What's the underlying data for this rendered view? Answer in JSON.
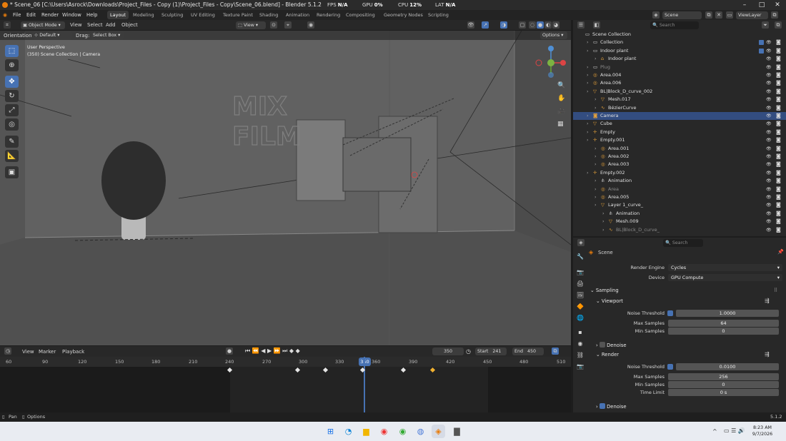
{
  "title_bar": {
    "title": "* Scene_06 [C:\\Users\\Asrock\\Downloads\\Project_Files - Copy (1)\\Project_Files - Copy\\Scene_06.blend] - Blender 5.1.2"
  },
  "stats": {
    "fps_label": "FPS",
    "fps_value": "N/A",
    "gpu_label": "GPU",
    "gpu_value": "0%",
    "cpu_label": "CPU",
    "cpu_value": "12%",
    "lat_label": "LAT",
    "lat_value": "N/A"
  },
  "menu": {
    "file": "File",
    "edit": "Edit",
    "render": "Render",
    "window": "Window",
    "help": "Help"
  },
  "workspaces": [
    "Layout",
    "Modeling",
    "Sculpting",
    "UV Editing",
    "Texture Paint",
    "Shading",
    "Animation",
    "Rendering",
    "Compositing",
    "Geometry Nodes",
    "Scripting"
  ],
  "scene_field": "Scene",
  "viewlayer_field": "ViewLayer",
  "viewport_header": {
    "mode": "Object Mode",
    "view": "View",
    "select": "Select",
    "add": "Add",
    "object": "Object",
    "view_dd": "View",
    "options": "Options"
  },
  "viewport_header2": {
    "orientation_label": "Orientation:",
    "orientation": "Default",
    "drag_label": "Drag:",
    "drag": "Select Box"
  },
  "viewport_overlay": {
    "line1": "User Perspective",
    "line2": "(350) Scene Collection | Camera"
  },
  "viewport_text": {
    "mix": "MIX",
    "film": "FILM"
  },
  "timeline": {
    "editor_menu": [
      "View",
      "Marker",
      "Playback"
    ],
    "current_frame": "350",
    "start_label": "Start",
    "start": "241",
    "end_label": "End",
    "end": "450",
    "ruler": [
      "60",
      "90",
      "120",
      "150",
      "180",
      "210",
      "240",
      "270",
      "300",
      "330",
      "360",
      "390",
      "420",
      "450",
      "480",
      "510"
    ],
    "playhead": "350"
  },
  "outliner": {
    "search_placeholder": "Search",
    "rows": [
      {
        "label": "Scene Collection",
        "indent": 0,
        "icon": "collection-icon"
      },
      {
        "label": "Collection",
        "indent": 1,
        "icon": "collection-icon"
      },
      {
        "label": "Indoor plant",
        "indent": 1,
        "icon": "collection-icon"
      },
      {
        "label": "Indoor plant",
        "indent": 2,
        "icon": "object-icon"
      },
      {
        "label": "Plug",
        "indent": 1,
        "icon": "collection-icon"
      },
      {
        "label": "Area.004",
        "indent": 1,
        "icon": "light-icon"
      },
      {
        "label": "Area.006",
        "indent": 1,
        "icon": "light-icon"
      },
      {
        "label": "BL|Block_D_curve_002",
        "indent": 1,
        "icon": "mesh-icon"
      },
      {
        "label": "Mesh.017",
        "indent": 2,
        "icon": "mesh-icon"
      },
      {
        "label": "BézierCurve",
        "indent": 2,
        "icon": "curve-icon"
      },
      {
        "label": "Camera",
        "indent": 1,
        "icon": "camera-icon"
      },
      {
        "label": "Cube",
        "indent": 1,
        "icon": "mesh-icon"
      },
      {
        "label": "Empty",
        "indent": 1,
        "icon": "empty-icon"
      },
      {
        "label": "Empty.001",
        "indent": 1,
        "icon": "empty-icon"
      },
      {
        "label": "Area.001",
        "indent": 2,
        "icon": "light-icon"
      },
      {
        "label": "Area.002",
        "indent": 2,
        "icon": "light-icon"
      },
      {
        "label": "Area.003",
        "indent": 2,
        "icon": "light-icon"
      },
      {
        "label": "Empty.002",
        "indent": 1,
        "icon": "empty-icon"
      },
      {
        "label": "Animation",
        "indent": 2,
        "icon": "action-icon"
      },
      {
        "label": "Area",
        "indent": 2,
        "icon": "light-icon"
      },
      {
        "label": "Area.005",
        "indent": 2,
        "icon": "light-icon"
      },
      {
        "label": "Layer 1_curve_",
        "indent": 2,
        "icon": "mesh-icon"
      },
      {
        "label": "Animation",
        "indent": 3,
        "icon": "action-icon"
      },
      {
        "label": "Mesh.009",
        "indent": 3,
        "icon": "mesh-icon"
      },
      {
        "label": "BL|Block_D_curve_",
        "indent": 3,
        "icon": "curve-icon"
      }
    ]
  },
  "properties": {
    "search_placeholder": "Search",
    "context": "Scene",
    "render_engine_label": "Render Engine",
    "render_engine": "Cycles",
    "device_label": "Device",
    "device": "GPU Compute",
    "sampling": "Sampling",
    "viewport": "Viewport",
    "vp_noise_threshold_label": "Noise Threshold",
    "vp_noise_threshold": "1.0000",
    "vp_max_samples_label": "Max Samples",
    "vp_max_samples": "64",
    "vp_min_samples_label": "Min Samples",
    "vp_min_samples": "0",
    "vp_denoise": "Denoise",
    "render": "Render",
    "r_noise_threshold_label": "Noise Threshold",
    "r_noise_threshold": "0.0100",
    "r_max_samples_label": "Max Samples",
    "r_max_samples": "256",
    "r_min_samples_label": "Min Samples",
    "r_min_samples": "0",
    "r_time_limit_label": "Time Limit",
    "r_time_limit": "0 s",
    "r_denoise": "Denoise"
  },
  "status_bar": {
    "pan": "Pan",
    "options": "Options",
    "version": "5.1.2"
  },
  "taskbar": {
    "time": "8:23 AM",
    "date": "9/7/2026"
  },
  "colors": {
    "accent": "#4772b3",
    "selected_row": "#334d80",
    "playhead": "#4772b3"
  }
}
